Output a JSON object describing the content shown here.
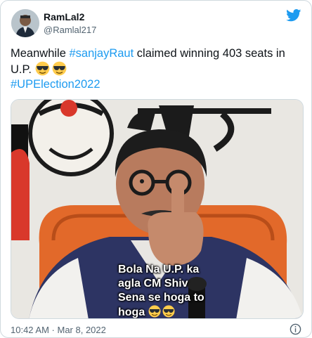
{
  "tweet": {
    "display_name": "RamLal2",
    "handle": "@Ramlal217",
    "text_before": "Meanwhile ",
    "hashtag1": "#sanjayRaut",
    "text_after": " claimed winning 403 seats in U.P. ",
    "hashtag2": "#UPElection2022",
    "emoji_icon": "sunglasses-emoji-icon",
    "media": {
      "caption_lines": [
        "Bola Na U.P. ka",
        "agla CM Shiv",
        "Sena se hoga to",
        "hoga "
      ]
    },
    "time": "10:42 AM",
    "separator": " · ",
    "date": "Mar 8, 2022"
  },
  "colors": {
    "accent": "#1d9bf0",
    "muted": "#536471",
    "text": "#0f1419",
    "border": "#cfd9de"
  }
}
